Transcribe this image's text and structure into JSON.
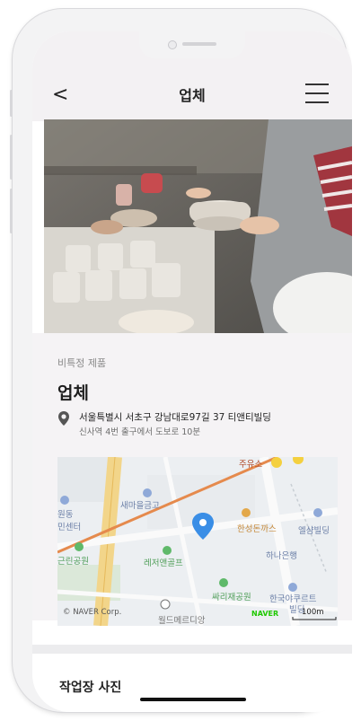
{
  "header": {
    "back_label": "<",
    "title": "업체"
  },
  "shop": {
    "category": "비특정 제품",
    "name": "업체",
    "address": "서울특별시 서초구 강남대로97길 37 티앤티빌딩",
    "directions": "신사역 4번 출구에서 도보로 10분"
  },
  "map": {
    "labels": {
      "jusso": "주유소",
      "saemaeul": "새마을금고",
      "hanseong": "한성돈까스",
      "elsam": "엘샴빌딩",
      "hana": "하나은행",
      "lejeo": "레저앤골프",
      "ssari": "싸리재공원",
      "hanguk": "한국야쿠르트",
      "worldmedi": "월드메르디앙",
      "gunwon": "근린공원",
      "dong": "동",
      "center": "민센터",
      "wondong": "원동",
      "copyright": "© NAVER Corp.",
      "naver": "NAVER",
      "scale": "100m",
      "bil": "빌딩"
    }
  },
  "section2": {
    "title": "작업장 사진"
  }
}
